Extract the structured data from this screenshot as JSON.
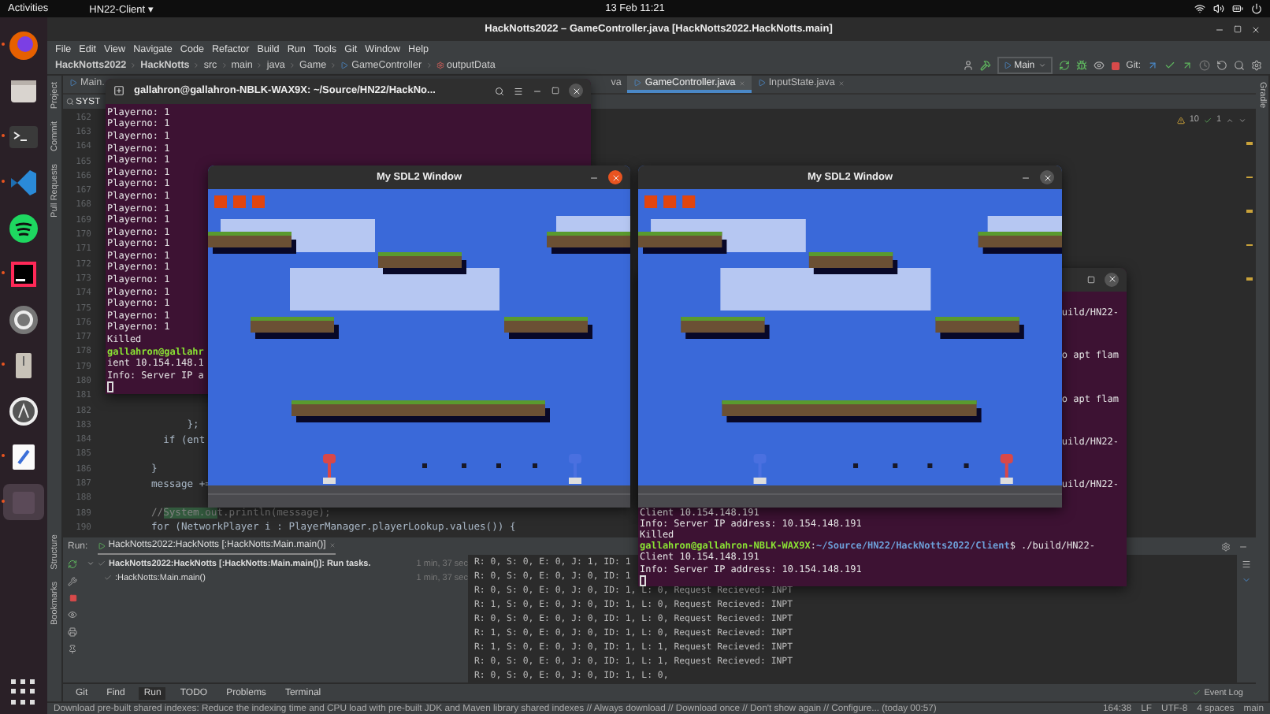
{
  "top_bar": {
    "activities": "Activities",
    "app_menu": "HN22-Client ▾",
    "clock": "13 Feb 11:21"
  },
  "dock": {
    "apps": [
      {
        "kind": "firefox",
        "running": true,
        "selected": false
      },
      {
        "kind": "files",
        "running": false,
        "selected": false
      },
      {
        "kind": "terminal",
        "running": true,
        "selected": false
      },
      {
        "kind": "vscode",
        "running": true,
        "selected": false
      },
      {
        "kind": "spotify",
        "running": false,
        "selected": false
      },
      {
        "kind": "intellij",
        "running": true,
        "selected": false
      },
      {
        "kind": "settings",
        "running": false,
        "selected": false
      },
      {
        "kind": "drive",
        "running": true,
        "selected": false
      },
      {
        "kind": "software",
        "running": false,
        "selected": false
      },
      {
        "kind": "editor",
        "running": true,
        "selected": false
      },
      {
        "kind": "blank",
        "running": true,
        "selected": true
      }
    ]
  },
  "ide": {
    "title": "HackNotts2022 – GameController.java [HackNotts2022.HackNotts.main]",
    "menu": [
      "File",
      "Edit",
      "View",
      "Navigate",
      "Code",
      "Refactor",
      "Build",
      "Run",
      "Tools",
      "Git",
      "Window",
      "Help"
    ],
    "breadcrumb": [
      "HackNotts2022",
      "HackNotts",
      "src",
      "main",
      "java",
      "Game",
      "GameController",
      "outputData"
    ],
    "run_config": "Main",
    "git_label": "Git:",
    "left_stripe_top": [
      "Project",
      "Commit",
      "Pull Requests"
    ],
    "left_stripe_bottom": [
      "Structure",
      "Bookmarks"
    ],
    "right_stripe": [
      "Gradle"
    ],
    "tabs": [
      {
        "label": "Main.",
        "selected": false
      },
      {
        "label": "va",
        "selected": false
      },
      {
        "label": "GameController.java",
        "selected": true
      },
      {
        "label": "InputState.java",
        "selected": false
      }
    ],
    "find": {
      "value": "SYST"
    },
    "inspections": {
      "warnings": "10",
      "ok": "1"
    },
    "lines": [
      {
        "number": "162"
      },
      {
        "number": "163"
      },
      {
        "number": "164"
      },
      {
        "number": "165"
      },
      {
        "number": "166"
      },
      {
        "number": "167"
      },
      {
        "number": "168"
      },
      {
        "number": "169"
      },
      {
        "number": "170"
      },
      {
        "number": "171"
      },
      {
        "number": "172"
      },
      {
        "number": "173"
      },
      {
        "number": "174"
      },
      {
        "number": "175"
      },
      {
        "number": "176"
      },
      {
        "number": "177"
      },
      {
        "number": "178"
      },
      {
        "number": "179"
      },
      {
        "number": "180"
      },
      {
        "number": "181"
      },
      {
        "number": "182"
      },
      {
        "number": "183",
        "code": [
          {
            "text": "      };",
            "match": false
          }
        ]
      },
      {
        "number": "184",
        "code": [
          {
            "text": "  if (ent",
            "match": false
          }
        ]
      },
      {
        "number": "185"
      },
      {
        "number": "186",
        "code": [
          {
            "text": "}",
            "match": false
          }
        ]
      },
      {
        "number": "187",
        "code": [
          {
            "text": "message +=",
            "match": false
          }
        ]
      },
      {
        "number": "188"
      },
      {
        "number": "189",
        "code": [
          {
            "text": "//",
            "match": false
          },
          {
            "text": "System.ou",
            "match": true
          },
          {
            "text": "t.println(message);",
            "match": false
          }
        ]
      },
      {
        "number": "190",
        "code": [
          {
            "text": "for (NetworkPlayer i : PlayerManager.playerLookup.values()) {",
            "match": false
          }
        ]
      }
    ],
    "run": {
      "label": "Run:",
      "tab": "HackNotts2022:HackNotts [:HackNotts:Main.main()]",
      "tree": [
        {
          "label": "HackNotts2022:HackNotts [:HackNotts:Main.main()]: Run tasks.",
          "time": "1 min, 37 sec",
          "expanded": true,
          "children": [
            {
              "label": ":HackNotts:Main.main()",
              "time": "1 min, 37 sec"
            }
          ]
        }
      ],
      "output": [
        "R: 0, S: 0, E: 0, J: 1, ID: 1",
        "R: 0, S: 0, E: 0, J: 0, ID: 1",
        "R: 0, S: 0, E: 0, J: 0, ID: 1, L: 0, Request Recieved: INPT",
        "R: 1, S: 0, E: 0, J: 0, ID: 1, L: 0, Request Recieved: INPT",
        "R: 0, S: 0, E: 0, J: 0, ID: 1, L: 0, Request Recieved: INPT",
        "R: 1, S: 0, E: 0, J: 0, ID: 1, L: 0, Request Recieved: INPT",
        "R: 1, S: 0, E: 0, J: 0, ID: 1, L: 1, Request Recieved: INPT",
        "R: 0, S: 0, E: 0, J: 0, ID: 1, L: 1, Request Recieved: INPT",
        "R: 0, S: 0, E: 0, J: 0, ID: 1, L: 0,"
      ]
    },
    "tool_tabs": [
      {
        "label": "Git",
        "selected": false
      },
      {
        "label": "Find",
        "selected": false
      },
      {
        "label": "Run",
        "selected": true
      },
      {
        "label": "TODO",
        "selected": false
      },
      {
        "label": "Problems",
        "selected": false
      },
      {
        "label": "Terminal",
        "selected": false
      }
    ],
    "event_log": "Event Log",
    "status": {
      "message": "Download pre-built shared indexes: Reduce the indexing time and CPU load with pre-built JDK and Maven library shared indexes // Always download // Download once // Don't show again // Configure... (today 00:57)",
      "position": "164:38",
      "line_ending": "LF",
      "encoding": "UTF-8",
      "indent": "4 spaces",
      "branch": "main"
    }
  },
  "terminals": [
    {
      "title": "gallahron@gallahron-NBLK-WAX9X: ~/Source/HN22/HackNo...",
      "lines": [
        {
          "kind": "text",
          "text": "Playerno: 1"
        },
        {
          "kind": "text",
          "text": "Playerno: 1"
        },
        {
          "kind": "text",
          "text": "Playerno: 1"
        },
        {
          "kind": "text",
          "text": "Playerno: 1"
        },
        {
          "kind": "text",
          "text": "Playerno: 1"
        },
        {
          "kind": "text",
          "text": "Playerno: 1"
        },
        {
          "kind": "text",
          "text": "Playerno: 1"
        },
        {
          "kind": "text",
          "text": "Playerno: 1"
        },
        {
          "kind": "text",
          "text": "Playerno: 1"
        },
        {
          "kind": "text",
          "text": "Playerno: 1"
        },
        {
          "kind": "text",
          "text": "Playerno: 1"
        },
        {
          "kind": "text",
          "text": "Playerno: 1"
        },
        {
          "kind": "text",
          "text": "Playerno: 1"
        },
        {
          "kind": "text",
          "text": "Playerno: 1"
        },
        {
          "kind": "text",
          "text": "Playerno: 1"
        },
        {
          "kind": "text",
          "text": "Playerno: 1"
        },
        {
          "kind": "text",
          "text": "Playerno: 1"
        },
        {
          "kind": "text",
          "text": "Playerno: 1"
        },
        {
          "kind": "text",
          "text": "Playerno: 1"
        },
        {
          "kind": "text",
          "text": "Killed"
        },
        {
          "kind": "prompt",
          "parts": [
            {
              "kind": "user",
              "text": "gallahron@gallahr"
            }
          ]
        },
        {
          "kind": "text",
          "text": "ient 10.154.148.1"
        },
        {
          "kind": "text",
          "text": "Info: Server IP a"
        },
        {
          "kind": "cursor"
        }
      ]
    },
    {
      "tails": [
        "uild/HN22-",
        "o apt flam",
        "o apt flam",
        "uild/HN22-",
        "uild/HN22-"
      ],
      "lines": [
        {
          "kind": "text",
          "text": "Client 10.154.148.191"
        },
        {
          "kind": "text",
          "text": "Info: Server IP address: 10.154.148.191"
        },
        {
          "kind": "text",
          "text": "Killed"
        },
        {
          "kind": "prompt",
          "parts": [
            {
              "kind": "user",
              "text": "gallahron@gallahron-NBLK-WAX9X"
            },
            {
              "kind": "plain",
              "text": ":"
            },
            {
              "kind": "path",
              "text": "~/Source/HN22/HackNotts2022/Client"
            },
            {
              "kind": "plain",
              "text": "$ ./build/HN22-"
            }
          ]
        },
        {
          "kind": "text",
          "text": "Client 10.154.148.191"
        },
        {
          "kind": "text",
          "text": "Info: Server IP address: 10.154.148.191"
        },
        {
          "kind": "cursor"
        }
      ]
    }
  ],
  "game_windows": [
    {
      "title": "My SDL2 Window",
      "focused": true,
      "players": [
        {
          "color": "#d84848"
        },
        {
          "color": "#4a70e0"
        }
      ]
    },
    {
      "title": "My SDL2 Window",
      "focused": false,
      "players": [
        {
          "color": "#4a70e0"
        },
        {
          "color": "#d84848"
        }
      ]
    }
  ]
}
